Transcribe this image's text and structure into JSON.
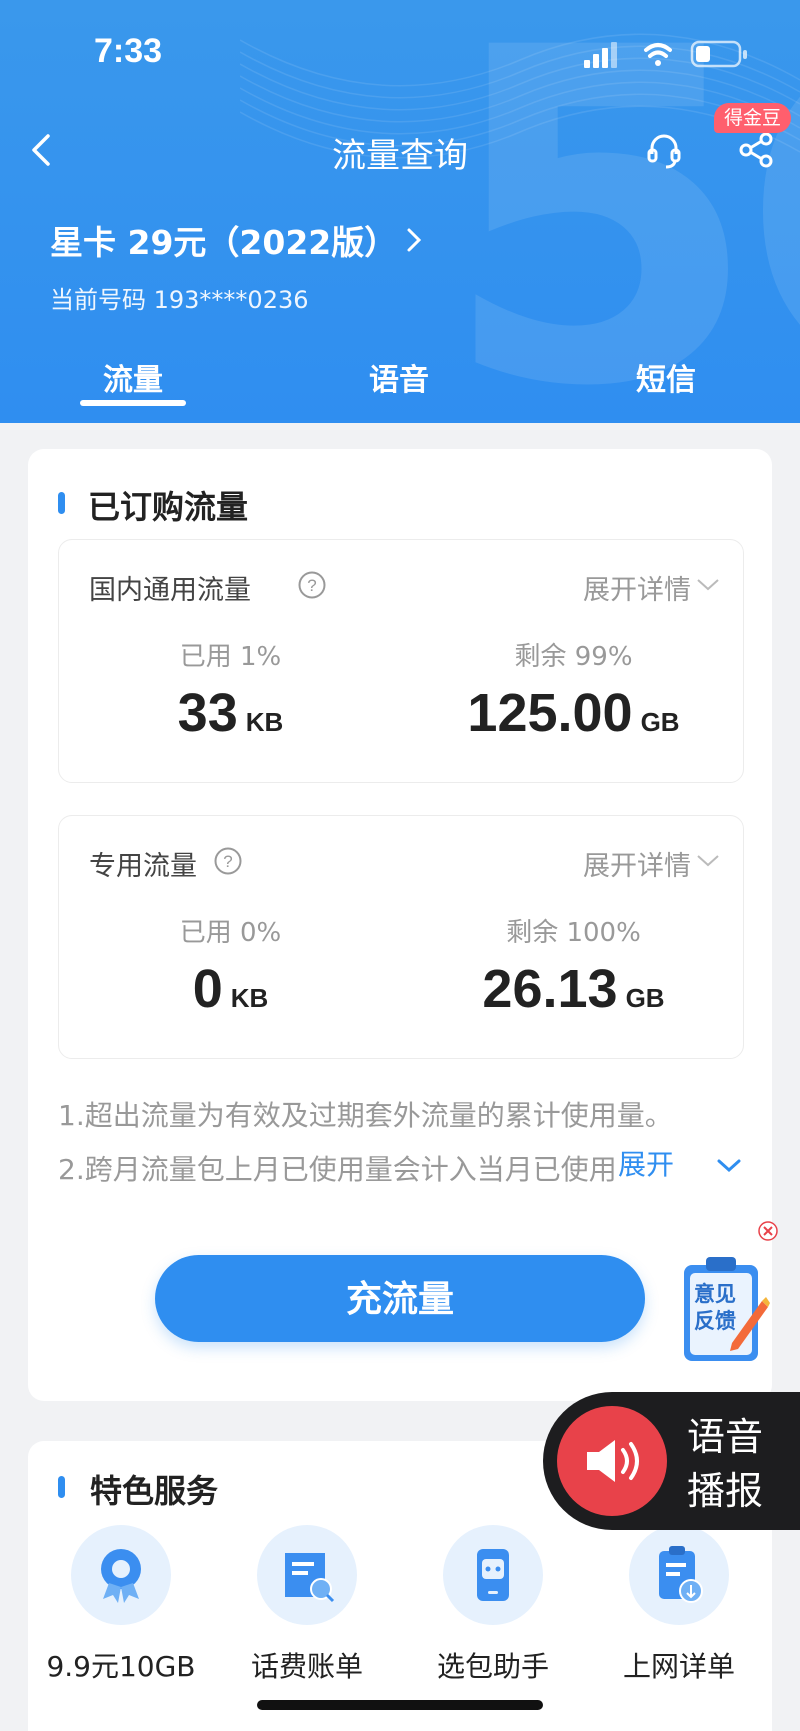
{
  "status_bar": {
    "time": "7:33"
  },
  "nav": {
    "title": "流量查询",
    "gold_badge": "得金豆"
  },
  "plan": {
    "name": "星卡 29元（2022版）",
    "phone": "当前号码 193****0236"
  },
  "tabs": [
    {
      "label": "流量",
      "active": true
    },
    {
      "label": "语音",
      "active": false
    },
    {
      "label": "短信",
      "active": false
    }
  ],
  "purchased": {
    "title": "已订购流量",
    "domestic": {
      "label": "国内通用流量",
      "expand": "展开详情",
      "used_pct": "已用 1%",
      "used_value": "33",
      "used_unit": "KB",
      "remain_pct": "剩余 99%",
      "remain_value": "125.00",
      "remain_unit": "GB"
    },
    "dedicated": {
      "label": "专用流量",
      "expand": "展开详情",
      "used_pct": "已用 0%",
      "used_value": "0",
      "used_unit": "KB",
      "remain_pct": "剩余 100%",
      "remain_value": "26.13",
      "remain_unit": "GB"
    },
    "notes": [
      "1.超出流量为有效及过期套外流量的累计使用量。",
      "2.跨月流量包上月已使用量会计入当月已使用"
    ],
    "notes_expand": "展开",
    "topup_button": "充流量"
  },
  "feedback": {
    "line1": "意见",
    "line2": "反馈"
  },
  "voice": {
    "line1": "语音",
    "line2": "播报"
  },
  "services": {
    "title": "特色服务",
    "items": [
      {
        "label": "9.9元10GB",
        "icon": "award-icon"
      },
      {
        "label": "话费账单",
        "icon": "bill-icon"
      },
      {
        "label": "选包助手",
        "icon": "robot-phone-icon"
      },
      {
        "label": "上网详单",
        "icon": "clipboard-icon"
      }
    ]
  },
  "colors": {
    "primary": "#2f8ef0",
    "badge": "#ff5f6d",
    "voice": "#e8424a"
  }
}
